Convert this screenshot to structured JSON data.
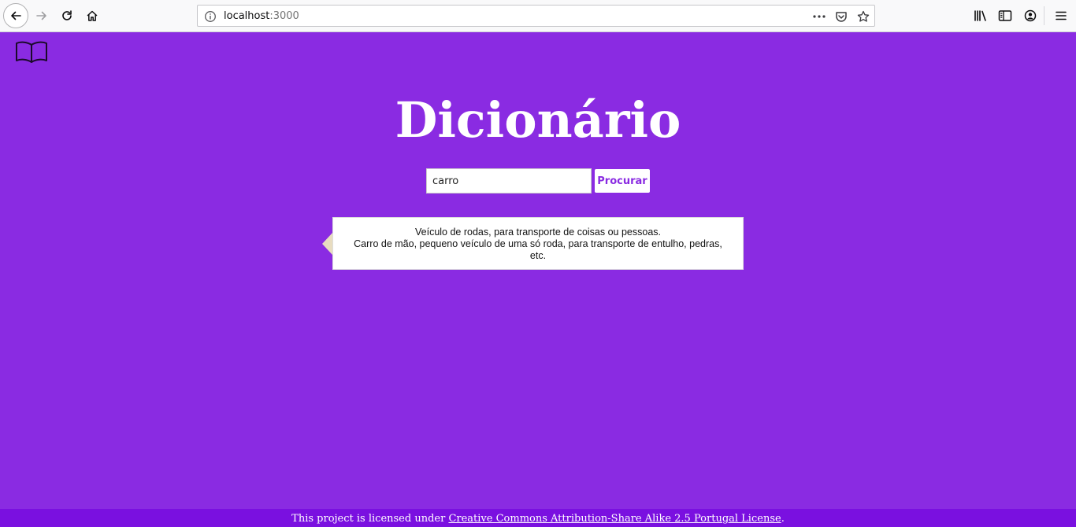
{
  "browser": {
    "url_host": "localhost",
    "url_port": ":3000"
  },
  "page": {
    "title": "Dicionário",
    "search": {
      "value": "carro",
      "button_label": "Procurar"
    },
    "result": {
      "lines": [
        "Veículo de rodas, para transporte de coisas ou pessoas.",
        "Carro de mão, pequeno veículo de uma só roda, para transporte de entulho, pedras, etc."
      ]
    },
    "footer": {
      "prefix": "This project is licensed under ",
      "link_text": "Creative Commons Attribution-Share Alike 2.5 Portugal License",
      "suffix": "."
    }
  },
  "colors": {
    "background": "#8a2be2",
    "footer": "#7a10e0",
    "accent_text": "#8a2be2"
  },
  "icons": {
    "logo": "open-book-icon"
  }
}
